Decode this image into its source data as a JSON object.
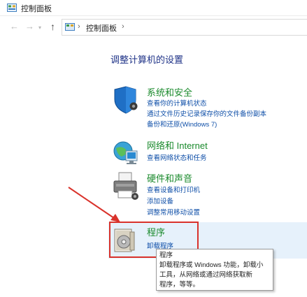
{
  "window": {
    "title": "控制面板"
  },
  "address": {
    "crumb": "控制面板",
    "separator": "›"
  },
  "nav": {
    "back": "←",
    "forward": "→",
    "recent": "▾",
    "up": "↑"
  },
  "heading": "调整计算机的设置",
  "categories": [
    {
      "title": "系统和安全",
      "links": [
        "查看你的计算机状态",
        "通过文件历史记录保存你的文件备份副本",
        "备份和还原(Windows 7)"
      ]
    },
    {
      "title": "网络和 Internet",
      "links": [
        "查看网络状态和任务"
      ]
    },
    {
      "title": "硬件和声音",
      "links": [
        "查看设备和打印机",
        "添加设备",
        "调整常用移动设置"
      ]
    },
    {
      "title": "程序",
      "links": [
        "卸载程序"
      ]
    }
  ],
  "tooltip": {
    "lines": [
      "程序",
      "卸载程序或 Windows 功能，卸载小",
      "工具，从网络或通过网络获取新",
      "程序，等等。"
    ]
  },
  "colors": {
    "highlight": "#e6f1fb",
    "annotation": "#d9322b",
    "link": "#0f4fa8",
    "category": "#1a8a2c"
  }
}
